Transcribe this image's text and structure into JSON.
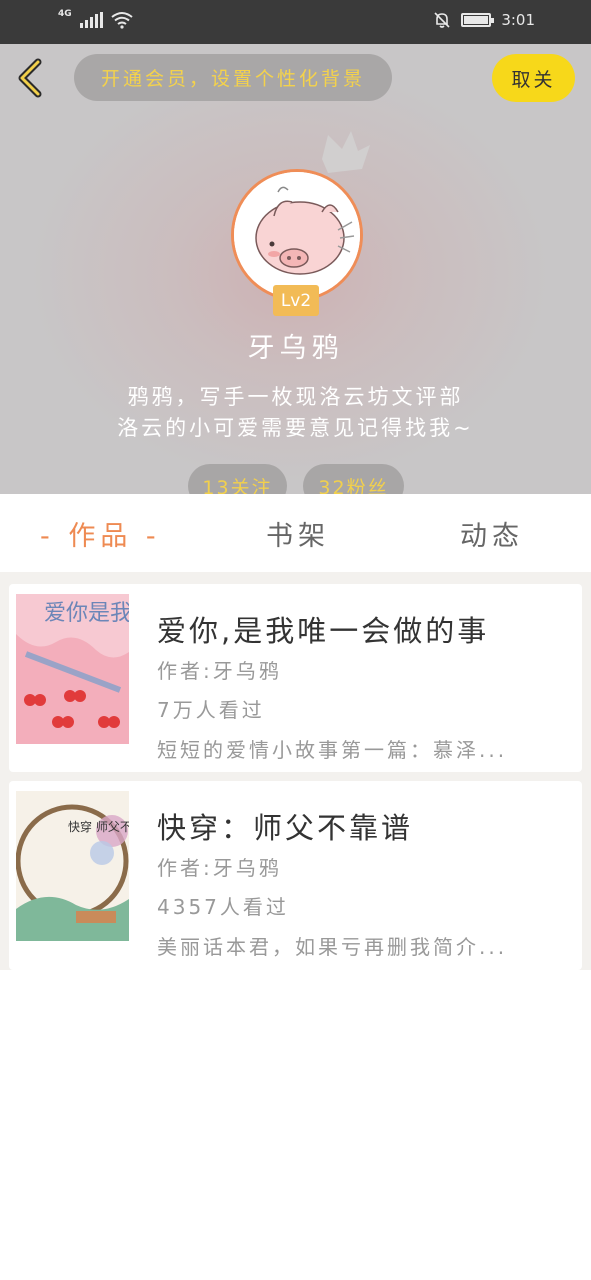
{
  "status_bar": {
    "network": "4G",
    "time": "3:01"
  },
  "header": {
    "vip_banner": "开通会员，设置个性化背景",
    "follow_button": "取关",
    "level": "Lv2",
    "username": "牙乌鸦",
    "bio_line1": "鸦鸦，写手一枚现洛云坊文评部",
    "bio_line2": "洛云的小可爱需要意见记得找我~",
    "following": "13关注",
    "fans": "32粉丝"
  },
  "tabs": [
    {
      "label": "- 作品 -"
    },
    {
      "label": "书架"
    },
    {
      "label": "动态"
    }
  ],
  "books": [
    {
      "title": "爱你,是我唯一会做的事",
      "author": "作者:牙乌鸦",
      "views": "7万人看过",
      "description": "短短的爱情小故事第一篇：慕泽...",
      "cover_text": "爱你是我"
    },
    {
      "title": "快穿：师父不靠谱",
      "author": "作者:牙乌鸦",
      "views": "4357人看过",
      "description": "美丽话本君，如果亏再删我简介...",
      "cover_text": "快穿 师父不靠谱"
    }
  ],
  "colors": {
    "accent_orange": "#ee8a52",
    "follow_yellow": "#f7d81a",
    "vip_text_yellow": "#f4d24b",
    "level_badge": "#f2bb56"
  }
}
